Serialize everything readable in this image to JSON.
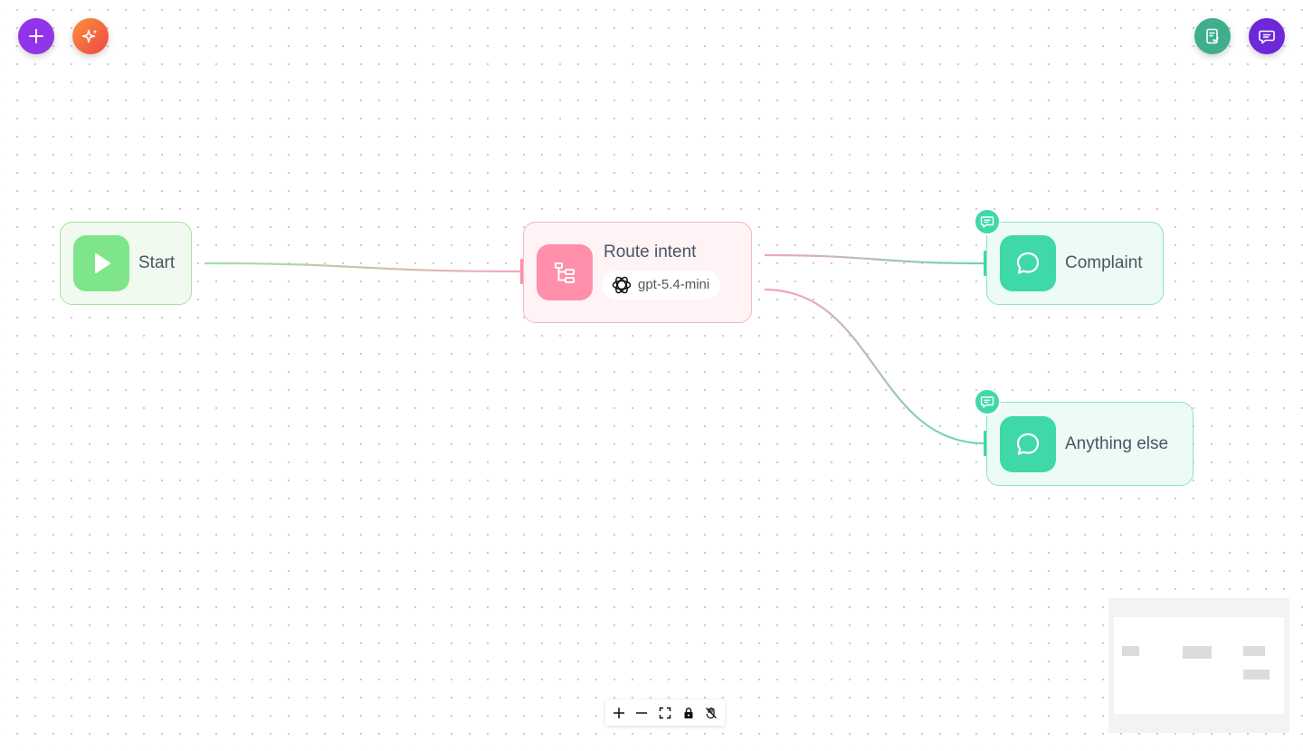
{
  "toolbar": {
    "add_icon": "plus-icon",
    "magic_icon": "sparkles-icon",
    "review_icon": "clipboard-check-icon",
    "chat_icon": "chat-icon"
  },
  "nodes": {
    "start": {
      "label": "Start",
      "icon": "play-icon",
      "color": "#7ee58a"
    },
    "route": {
      "label": "Route intent",
      "icon": "tree-structure-icon",
      "model": "gpt-5.4-mini",
      "model_icon": "openai-logo-icon",
      "color": "#ff8fab"
    },
    "complaint": {
      "label": "Complaint",
      "icon": "message-bubble-icon",
      "color": "#3fd8a9"
    },
    "anything": {
      "label": "Anything else",
      "icon": "message-bubble-icon",
      "color": "#3fd8a9"
    }
  },
  "controls": [
    "zoom-in",
    "zoom-out",
    "fit-view",
    "lock",
    "toggle-interactivity"
  ],
  "colors": {
    "add": "#9333ea",
    "magic": "#f97316",
    "review": "#3fae8c",
    "chat": "#6d28d9"
  }
}
